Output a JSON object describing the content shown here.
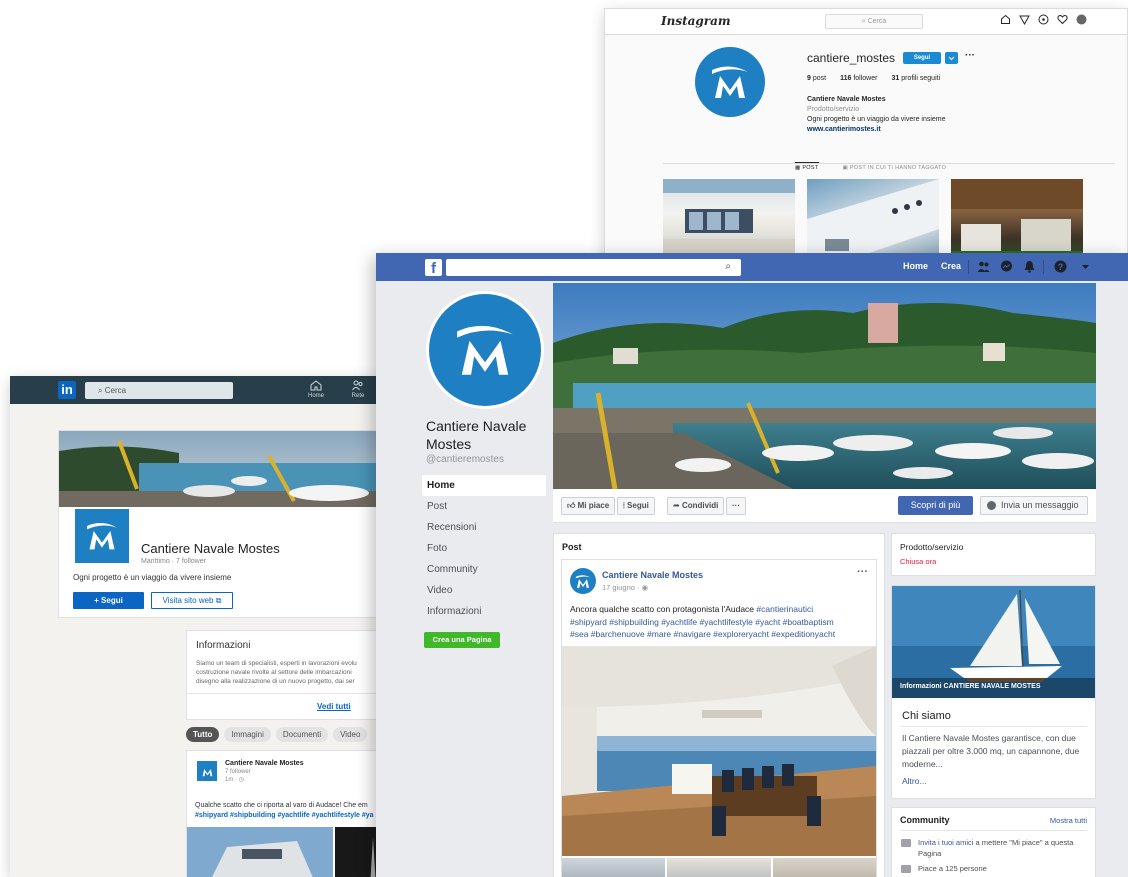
{
  "instagram": {
    "logo": "Instagram",
    "search_placeholder": "Cerca",
    "username": "cantiere_mostes",
    "follow_label": "Segui",
    "more_label": "···",
    "stats": [
      {
        "num": "9",
        "label": "post"
      },
      {
        "num": "116",
        "label": "follower"
      },
      {
        "num": "31",
        "label": "profili seguiti"
      }
    ],
    "bio": {
      "name": "Cantiere Navale Mostes",
      "category": "Prodotto/servizio",
      "text": "Ogni progetto è un viaggio da vivere insieme",
      "link": "www.cantierimostes.it"
    },
    "tabs": [
      "POST",
      "POST IN CUI TI HANNO TAGGATO"
    ],
    "icons": [
      "home-icon",
      "send-icon",
      "explore-icon",
      "heart-icon",
      "avatar-icon"
    ]
  },
  "linkedin": {
    "logo": "in",
    "search_placeholder": "Cerca",
    "nav": [
      {
        "label": "Home",
        "icon": "home-icon"
      },
      {
        "label": "Rete",
        "icon": "network-icon"
      }
    ],
    "company_name": "Cantiere Navale Mostes",
    "company_sub": "Marittimo · 7 follower",
    "tagline": "Ogni progetto è un viaggio da vivere insieme",
    "follow_label": "+ Segui",
    "site_label": "Visita sito web",
    "about": {
      "title": "Informazioni",
      "lines": [
        "Siamo un team di specialisti, esperti in lavorazioni evolu",
        "costruzione navale rivolte al settore delle imbarcazioni",
        "disegno alla realizzazione di un nuovo progetto, dai ser"
      ],
      "see_all": "Vedi tutti"
    },
    "filters": [
      "Tutto",
      "Immagini",
      "Documenti",
      "Video"
    ],
    "post": {
      "author": "Cantiere Navale Mostes",
      "followers": "7 follower",
      "time": "1m · ◷",
      "text": "Qualche scatto che ci riporta al varo di Audace! Che em",
      "tags": "#shipyard #shipbuilding #yachtlife #yachtlifestyle #ya"
    }
  },
  "facebook": {
    "logo": "f",
    "nav_home": "Home",
    "nav_create": "Crea",
    "page_name": "Cantiere Navale Mostes",
    "handle": "@cantieremostes",
    "left_nav": [
      "Home",
      "Post",
      "Recensioni",
      "Foto",
      "Community",
      "Video",
      "Informazioni"
    ],
    "create_page": "Crea una Pagina",
    "actions": {
      "like": "Mi piace",
      "follow": "Segui",
      "share": "Condividi",
      "more": "···"
    },
    "discover": "Scopri di più",
    "message": "Invia un messaggio",
    "posts_header": "Post",
    "post": {
      "author": "Cantiere Navale Mostes",
      "date": "17 giugno · ◉",
      "text": "Ancora qualche scatto con protagonista l'Audace",
      "tags_inline": "#cantierinautici",
      "tags_line2": "#shipyard #shipbuilding #yachtlife #yachtlifestyle #yacht #boatbaptism",
      "tags_line3": "#sea #barchenuove #mare #navigare #exploreryacht #expeditionyacht"
    },
    "category_card": {
      "category": "Prodotto/servizio",
      "status": "Chiusa ora"
    },
    "about_card": {
      "caption": "Informazioni CANTIERE NAVALE MOSTES",
      "title": "Chi siamo",
      "text": "Il Cantiere Navale Mostes garantisce, con due piazzali per oltre 3.000 mq, un capannone, due moderne...",
      "more": "Altro..."
    },
    "community": {
      "title": "Community",
      "see_all": "Mostra tutti",
      "invite_link": "Invita i tuoi amici",
      "invite_rest": " a mettere \"Mi piace\" a questa Pagina",
      "likes": "Piace a 125 persone"
    }
  }
}
